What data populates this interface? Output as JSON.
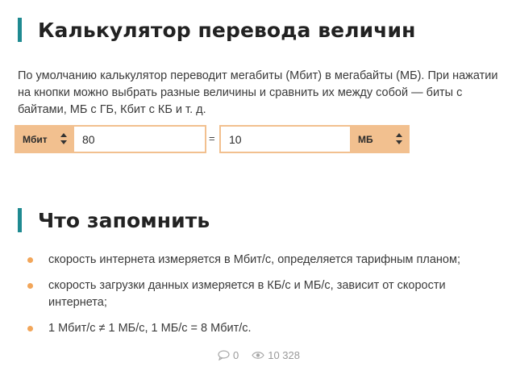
{
  "headings": {
    "main": "Калькулятор перевода величин",
    "remember": "Что запомнить"
  },
  "intro": "По умолчанию калькулятор переводит мегабиты (Мбит) в мегабайты (МБ). При нажатии на кнопки можно выбрать разные величины и сравнить их между собой — биты с байтами, МБ с ГБ, Кбит с КБ и т. д.",
  "calculator": {
    "left_unit": "Мбит",
    "left_value": "80",
    "equals": "=",
    "right_value": "10",
    "right_unit": "МБ"
  },
  "facts": [
    "скорость интернета измеряется в Мбит/с, определяется тарифным планом;",
    "скорость загрузки данных измеряется в КБ/с и МБ/с, зависит от скорости интернета;",
    "1 Мбит/с ≠ 1 МБ/с, 1 МБ/с = 8 Мбит/с."
  ],
  "meta": {
    "comments": "0",
    "views": "10 328",
    "comment_icon": "comment-icon",
    "views_icon": "eye-icon"
  },
  "colors": {
    "accent_bar": "#1f8a91",
    "unit_bg": "#f2c08f",
    "bullet": "#f2a65a"
  }
}
